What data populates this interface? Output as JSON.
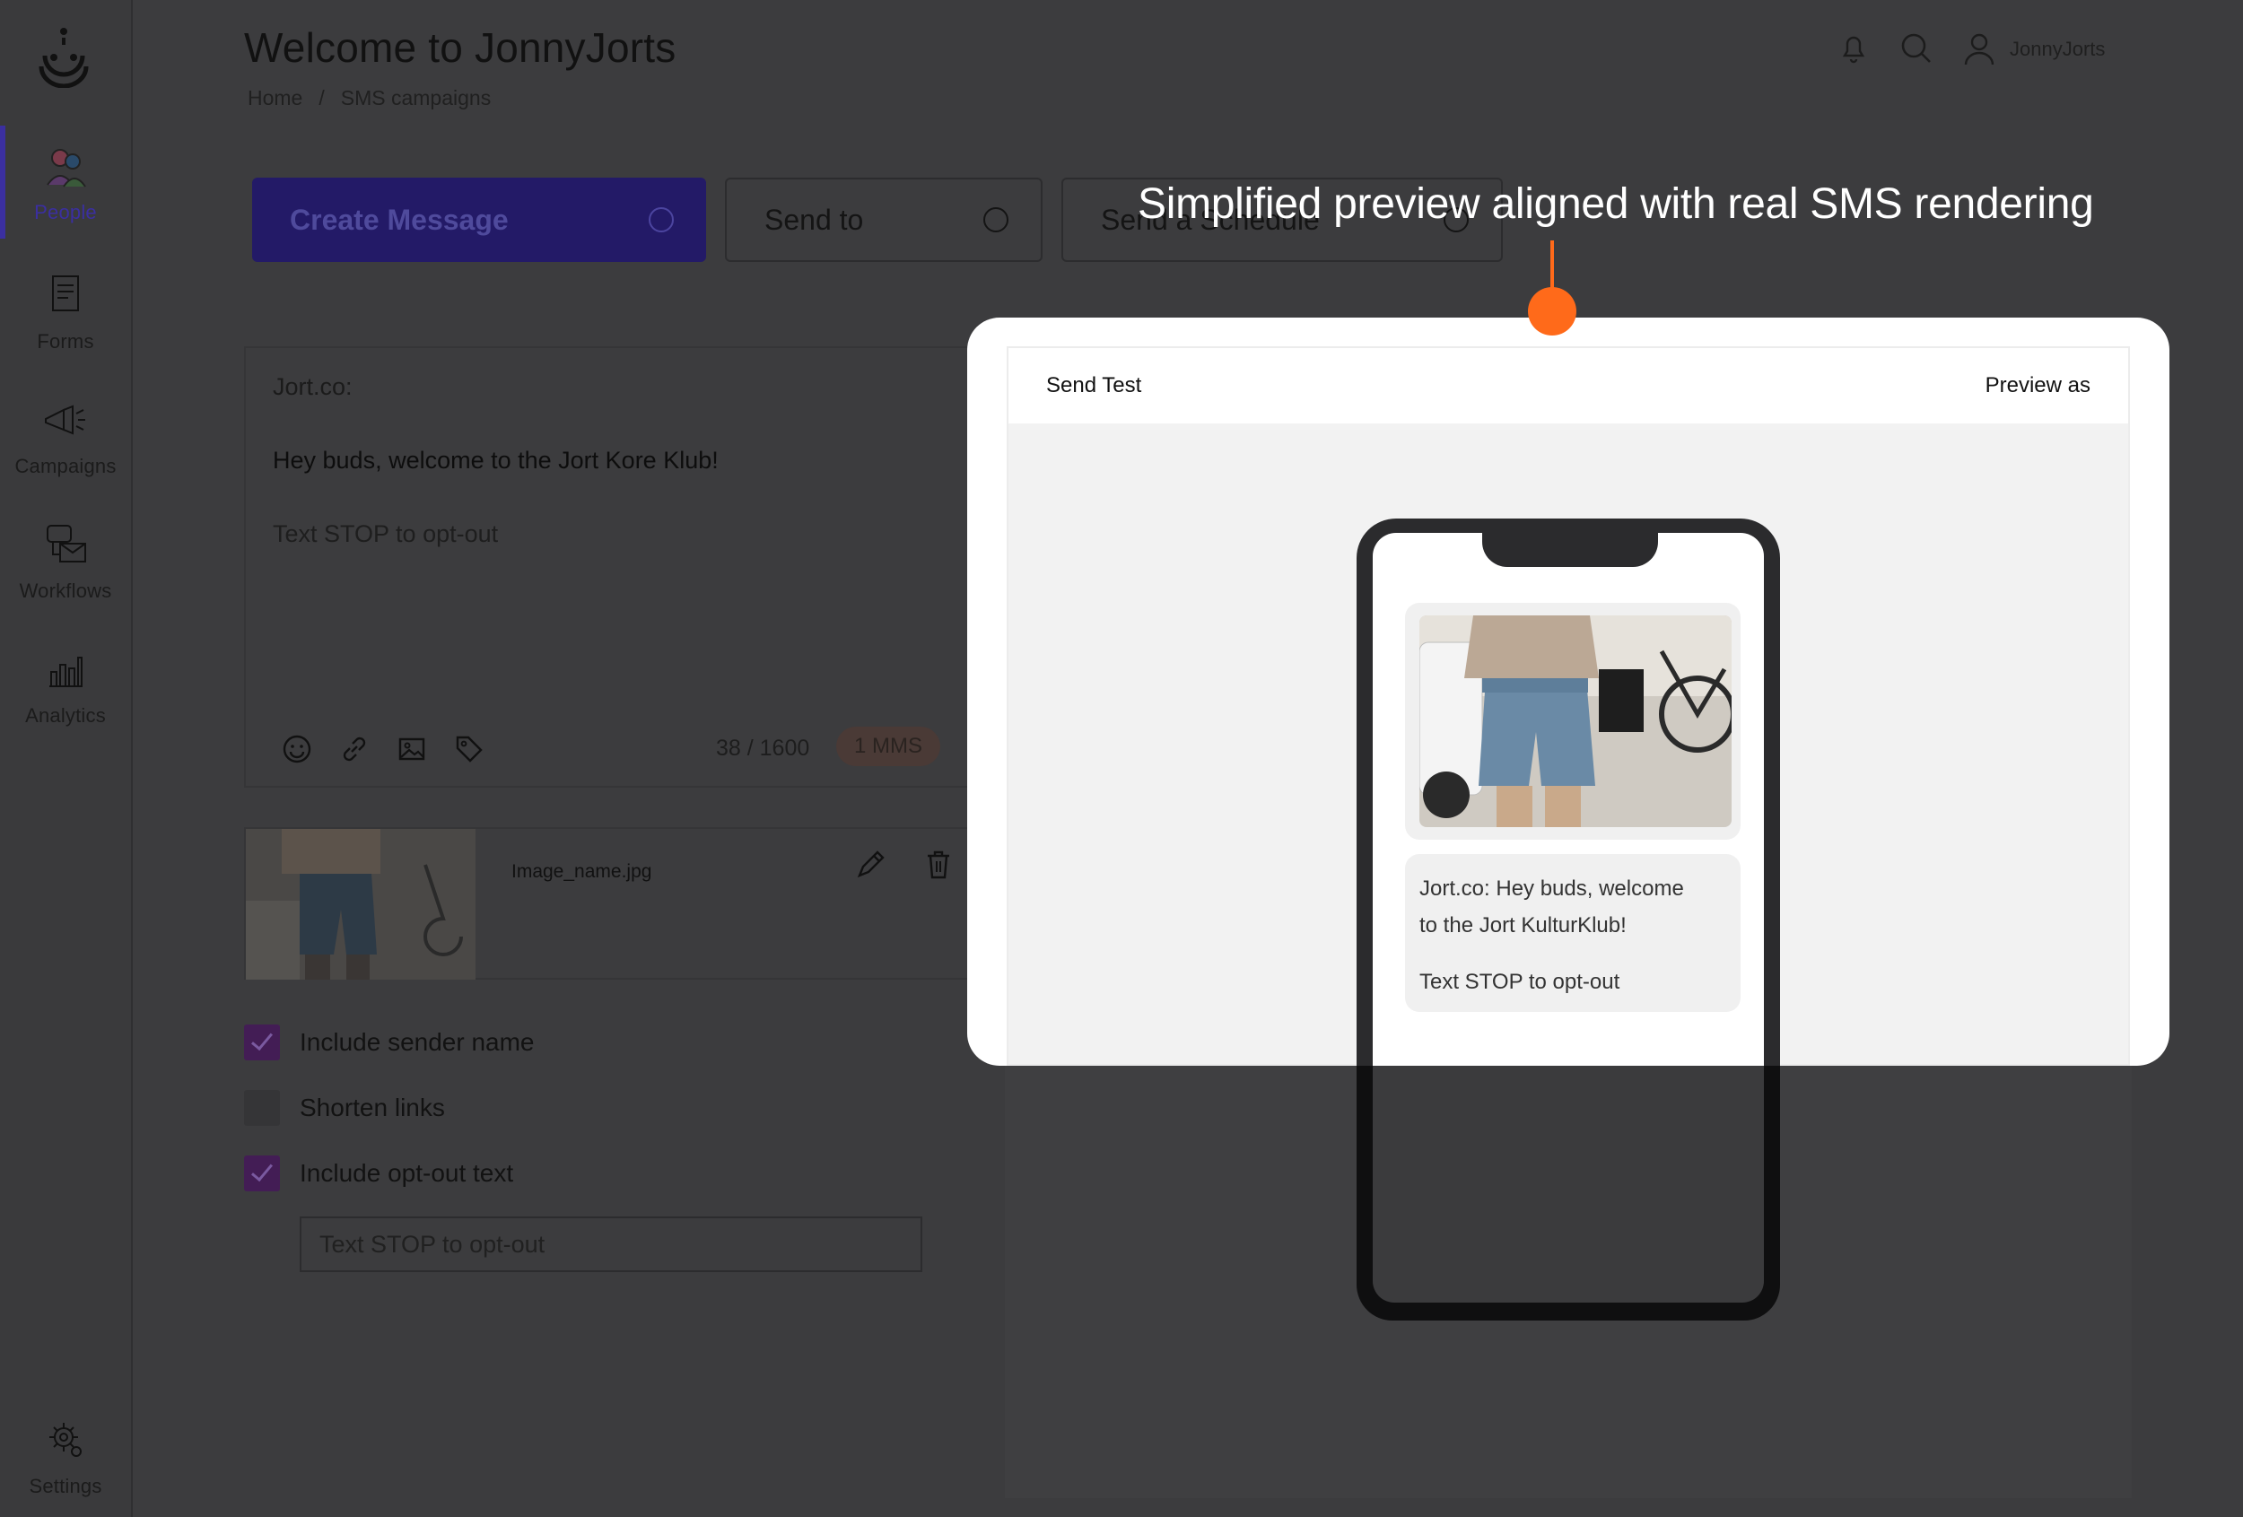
{
  "sidebar": {
    "items": [
      {
        "label": "People",
        "icon": "people-icon",
        "active": true
      },
      {
        "label": "Forms",
        "icon": "forms-icon"
      },
      {
        "label": "Campaigns",
        "icon": "megaphone-icon"
      },
      {
        "label": "Workflows",
        "icon": "workflows-icon"
      },
      {
        "label": "Analytics",
        "icon": "analytics-icon"
      }
    ],
    "settings_label": "Settings"
  },
  "header": {
    "title": "Welcome to JonnyJorts",
    "breadcrumb": [
      "Home",
      "SMS campaigns"
    ],
    "breadcrumb_sep": "/",
    "user_name": "JonnyJorts"
  },
  "steps": [
    {
      "label": "Create Message"
    },
    {
      "label": "Send to"
    },
    {
      "label": "Send a Schedule"
    }
  ],
  "editor": {
    "sender": "Jort.co:",
    "body": "Hey buds, welcome to the Jort Kore Klub!",
    "optout": "Text STOP to opt-out",
    "char_count": "38 / 1600",
    "mms_badge": "1 MMS"
  },
  "attachment": {
    "file_name": "Image_name.jpg"
  },
  "options": {
    "include_sender_name": {
      "label": "Include sender name",
      "checked": true
    },
    "shorten_links": {
      "label": "Shorten links",
      "checked": false
    },
    "include_optout": {
      "label": "Include opt-out text",
      "checked": true
    },
    "optout_placeholder": "Text STOP to opt-out"
  },
  "preview": {
    "send_test_label": "Send Test",
    "preview_as_label": "Preview as",
    "message_line1": "Jort.co: Hey buds, welcome",
    "message_line2": "to the Jort KulturKlub!",
    "message_optout": "Text STOP to opt-out"
  },
  "callout": {
    "text": "Simplified preview aligned with real SMS rendering",
    "color": "#ff6a1a"
  },
  "colors": {
    "brand_primary": "#3b2fa0",
    "checkbox_checked": "#431d55"
  }
}
